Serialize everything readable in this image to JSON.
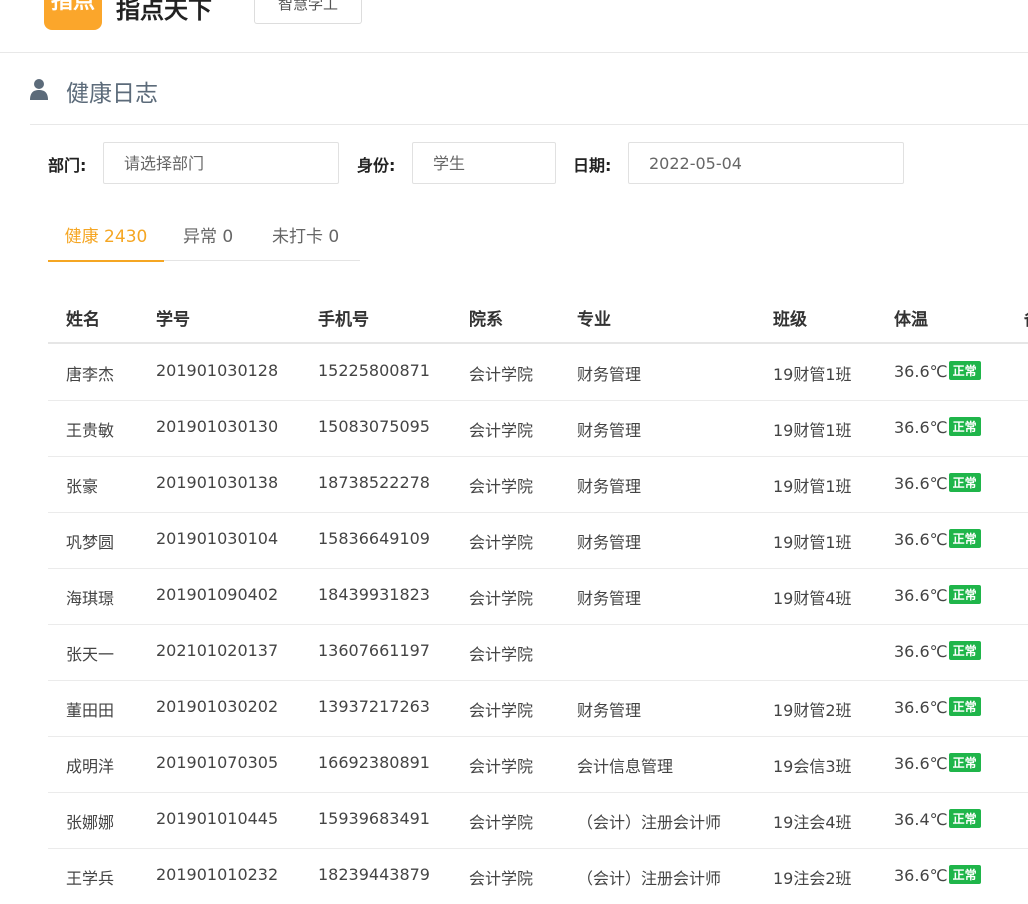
{
  "header": {
    "logo_text": "指点",
    "app_name": "指点天下",
    "top_tab": "智慧学工"
  },
  "page": {
    "title": "健康日志"
  },
  "filters": {
    "dept_label": "部门:",
    "dept_value": "请选择部门",
    "identity_label": "身份:",
    "identity_value": "学生",
    "date_label": "日期:",
    "date_value": "2022-05-04"
  },
  "tabs": [
    {
      "label": "健康 2430"
    },
    {
      "label": "异常 0"
    },
    {
      "label": "未打卡 0"
    }
  ],
  "table": {
    "columns": [
      "姓名",
      "学号",
      "手机号",
      "院系",
      "专业",
      "班级",
      "体温",
      "备"
    ],
    "rows": [
      {
        "name": "唐李杰",
        "id": "201901030128",
        "phone": "15225800871",
        "college": "会计学院",
        "major": "财务管理",
        "class": "19财管1班",
        "temp": "36.6℃",
        "status": "正常"
      },
      {
        "name": "王贵敏",
        "id": "201901030130",
        "phone": "15083075095",
        "college": "会计学院",
        "major": "财务管理",
        "class": "19财管1班",
        "temp": "36.6℃",
        "status": "正常"
      },
      {
        "name": "张豪",
        "id": "201901030138",
        "phone": "18738522278",
        "college": "会计学院",
        "major": "财务管理",
        "class": "19财管1班",
        "temp": "36.6℃",
        "status": "正常"
      },
      {
        "name": "巩梦圆",
        "id": "201901030104",
        "phone": "15836649109",
        "college": "会计学院",
        "major": "财务管理",
        "class": "19财管1班",
        "temp": "36.6℃",
        "status": "正常"
      },
      {
        "name": "海琪璟",
        "id": "201901090402",
        "phone": "18439931823",
        "college": "会计学院",
        "major": "财务管理",
        "class": "19财管4班",
        "temp": "36.6℃",
        "status": "正常"
      },
      {
        "name": "张天一",
        "id": "202101020137",
        "phone": "13607661197",
        "college": "会计学院",
        "major": "",
        "class": "",
        "temp": "36.6℃",
        "status": "正常"
      },
      {
        "name": "董田田",
        "id": "201901030202",
        "phone": "13937217263",
        "college": "会计学院",
        "major": "财务管理",
        "class": "19财管2班",
        "temp": "36.6℃",
        "status": "正常"
      },
      {
        "name": "成明洋",
        "id": "201901070305",
        "phone": "16692380891",
        "college": "会计学院",
        "major": "会计信息管理",
        "class": "19会信3班",
        "temp": "36.6℃",
        "status": "正常"
      },
      {
        "name": "张娜娜",
        "id": "201901010445",
        "phone": "15939683491",
        "college": "会计学院",
        "major": "（会计）注册会计师",
        "class": "19注会4班",
        "temp": "36.4℃",
        "status": "正常"
      },
      {
        "name": "王学兵",
        "id": "201901010232",
        "phone": "18239443879",
        "college": "会计学院",
        "major": "（会计）注册会计师",
        "class": "19注会2班",
        "temp": "36.6℃",
        "status": "正常"
      }
    ]
  }
}
